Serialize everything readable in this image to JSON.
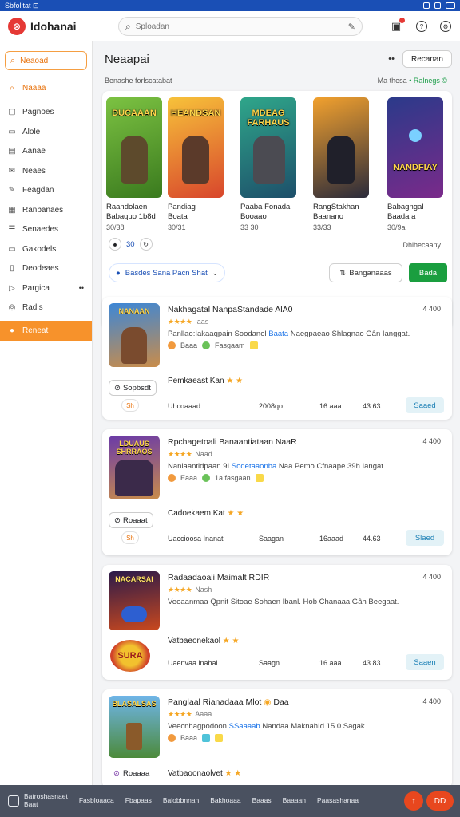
{
  "status_bar": {
    "left_text": "Sbfolitat ⊡",
    "icons": [
      "window-icon",
      "notification-icon",
      "battery-icon"
    ]
  },
  "app": {
    "brand": "Idohanai",
    "search_placeholder": "Sploadan"
  },
  "sidebar": {
    "search_label": "Neaoad",
    "items": [
      {
        "label": "Naaaa",
        "icon": "search-icon"
      },
      {
        "label": "Pagnoes",
        "icon": "clipboard-icon"
      },
      {
        "label": "Alole",
        "icon": "document-icon"
      },
      {
        "label": "Aanae",
        "icon": "folder-icon"
      },
      {
        "label": "Neaes",
        "icon": "mail-icon"
      },
      {
        "label": "Feagdan",
        "icon": "edit-icon"
      },
      {
        "label": "Ranbanaes",
        "icon": "grid-icon"
      },
      {
        "label": "Senaedes",
        "icon": "list-icon"
      },
      {
        "label": "Gakodels",
        "icon": "card-icon"
      },
      {
        "label": "Deodeaes",
        "icon": "page-icon"
      },
      {
        "label": "Pargica",
        "icon": "play-icon"
      },
      {
        "label": "Radis",
        "icon": "radio-icon"
      },
      {
        "label": "Reneat",
        "icon": "circle-icon"
      }
    ]
  },
  "main": {
    "title": "Neaapai",
    "header_button": "Recanan",
    "subline": "Benashe forlscatabat",
    "subline_right_a": "Ma thesa",
    "subline_right_b": "• Ralnegs ©",
    "featured": [
      {
        "cover_title": "DUCAAAN",
        "title": "Raandolaen\nBabaquo 1b8d",
        "meta": "30/38"
      },
      {
        "cover_title": "HEANDSAN",
        "title": "Pandiag\nBoata",
        "meta": "30/31"
      },
      {
        "cover_title": "MDEAG FARHAUS",
        "title": "Paaba Fonada\nBooaao",
        "meta": "33 30"
      },
      {
        "cover_title": "",
        "title": "RangStakhan\nBaanano",
        "meta": "33/33"
      },
      {
        "cover_title": "NANDFIAY",
        "title": "Babagngal\nBaada a",
        "meta": "30/9a"
      }
    ],
    "filter_chip": "30",
    "filter_right": "Dhlhecaany",
    "select_label": "Basdes Sana Pacn Shat",
    "sort_label": "Banganaaas",
    "primary_button": "Bada",
    "cards": [
      {
        "thumb_title": "NANAAN",
        "title": "Nakhagatal NanpaStandade AlA0",
        "time": "4 400",
        "stars": "★★★★",
        "stars_label": "Iaas",
        "desc_a": "Panllao:Iakaaqpain Soodanel ",
        "desc_hl": "Baata",
        "desc_b": " Naegpaeao Shlagnao Gân Ianggat.",
        "tag_a": "Baaa",
        "tag_b": "Fasgaam",
        "mid": "Pemkaeast Kan",
        "share": "Sopbsdt",
        "chip": "Sh",
        "stat_a": "Uhcoaaad",
        "stat_b": "2008qo",
        "stat_c": "16 aaa",
        "stat_d": "43.63",
        "action": "Saaed"
      },
      {
        "thumb_title": "LDUAUS SHRRAOS",
        "title": "Rpchagetoali Banaantiataan NaaR",
        "time": "4 400",
        "stars": "★★★★",
        "stars_label": "Naad",
        "desc_a": "Nanlaantidpaan 9I ",
        "desc_hl": "Sodetaaonba",
        "desc_b": " Naa Pemo Cfnaape 39h Iangat.",
        "tag_a": "Eaaa",
        "tag_b": "1a fasgaan",
        "mid": "Cadoekaem Kat",
        "share": "Roaaat",
        "chip": "Sh",
        "stat_a": "Uaccioosa Inanat",
        "stat_b": "Saagan",
        "stat_c": "16aaad",
        "stat_d": "44.63",
        "action": "Slaed"
      },
      {
        "thumb_title": "NACARSAI",
        "title": "Radaadaoali Maimalt RDIR",
        "time": "4 400",
        "stars": "★★★★",
        "stars_label": "Nash",
        "desc_a": "Veeaanmaa Qpnit Sitoae Sohaen Ibanl. Hob Chanaaa Gâh Beegaat.",
        "desc_hl": "",
        "desc_b": "",
        "tag_a": "",
        "tag_b": "",
        "mid": "Vatbaeonekaol",
        "share": "",
        "chip": "",
        "stat_a": "Uaenvaa lnahal",
        "stat_b": "Saagn",
        "stat_c": "16 aaa",
        "stat_d": "43.83",
        "action": "Saaen"
      },
      {
        "thumb_title": "BLASALSAS",
        "title": "Panglaal Rianadaaa Mlot",
        "title_tail": "Daa",
        "time": "4 400",
        "stars": "★★★★",
        "stars_label": "Aaaa",
        "desc_a": "Veecnhagpodoon ",
        "desc_hl": "SSaaaab",
        "desc_b": " Nandaa MaknahId 15 0 Sagak.",
        "tag_a": "Baaa",
        "tag_b": "",
        "mid": "Vatbaoonaolvet",
        "share": "Roaaaa",
        "chip": "",
        "stat_a": "",
        "stat_b": "",
        "stat_c": "",
        "stat_d": "",
        "action": ""
      }
    ]
  },
  "bottom_bar": {
    "items": [
      "Batroshasnaet\nBaat",
      "Fasbloaaca",
      "Fbapaas",
      "Balobbnnan",
      "Bakhoaaa",
      "Baaas",
      "Baaaan",
      "Paasashanaa"
    ],
    "fab_a": "↑",
    "fab_b": "DD"
  },
  "colors": {
    "accent": "#f7922b",
    "brand_red": "#e53935",
    "primary_green": "#1a9e3f",
    "status_blue": "#1a4fb5"
  }
}
